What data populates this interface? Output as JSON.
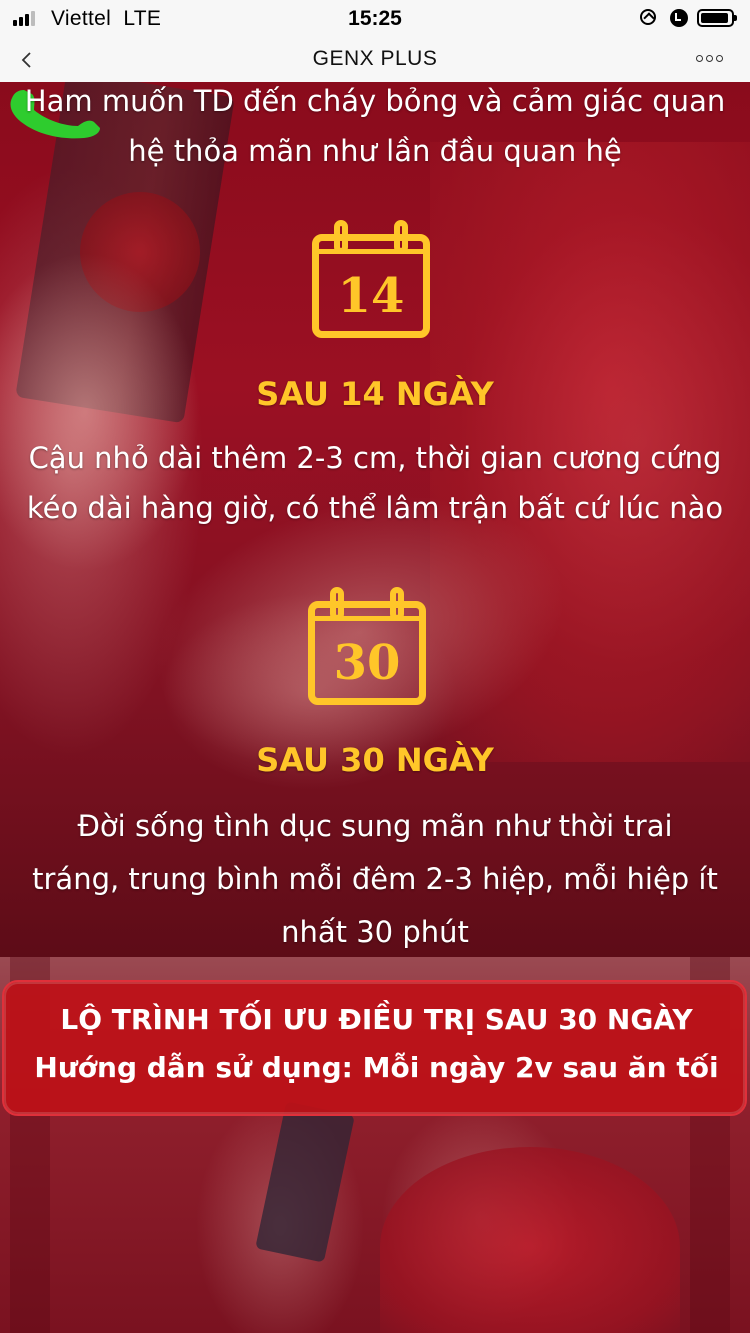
{
  "status_bar": {
    "carrier": "Viettel",
    "network": "LTE",
    "time": "15:25"
  },
  "nav": {
    "title": "GENX PLUS"
  },
  "content": {
    "intro_lines": [
      "Ham muốn TD đến cháy bỏng và cảm giác quan",
      "hệ thỏa mãn như lần đầu quan hệ"
    ],
    "milestones": [
      {
        "day": "14",
        "heading": "SAU 14 NGÀY",
        "lines": [
          "Cậu nhỏ dài thêm 2-3 cm, thời gian cương cứng",
          "kéo dài hàng giờ, có thể lâm trận bất cứ lúc nào"
        ]
      },
      {
        "day": "30",
        "heading": "SAU 30 NGÀY",
        "lines": [
          "Đời sống tình dục sung mãn như thời trai",
          "tráng, trung bình mỗi đêm 2-3 hiệp, mỗi hiệp ít",
          "nhất 30 phút"
        ]
      }
    ]
  },
  "promo": {
    "title": "LỘ TRÌNH TỐI ƯU ĐIỀU TRỊ SAU 30 NGÀY",
    "subtitle": "Hướng dẫn sử dụng: Mỗi ngày 2v sau ăn tối"
  },
  "colors": {
    "accent_yellow": "#ffc629",
    "banner_red": "#bd1118",
    "background_red": "#8a0b1c",
    "phone_green": "#2ecc2e"
  },
  "icons": [
    "signal-icon",
    "lock-rotation-icon",
    "alarm-icon",
    "battery-icon",
    "back-icon",
    "more-icon",
    "phone-icon",
    "calendar-icon"
  ]
}
